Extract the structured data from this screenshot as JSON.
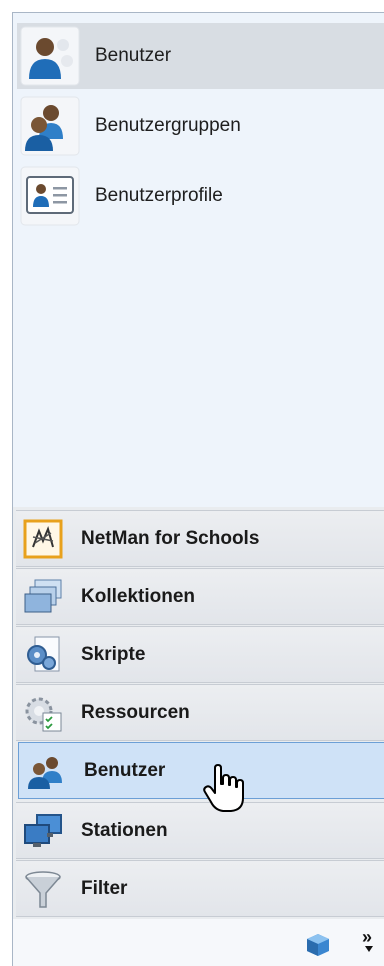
{
  "list": {
    "items": [
      {
        "label": "Benutzer",
        "icon": "user-icon",
        "selected": true
      },
      {
        "label": "Benutzergruppen",
        "icon": "user-group-icon",
        "selected": false
      },
      {
        "label": "Benutzerprofile",
        "icon": "user-profile-icon",
        "selected": false
      }
    ]
  },
  "nav": {
    "items": [
      {
        "label": "NetMan for Schools",
        "icon": "netman-icon"
      },
      {
        "label": "Kollektionen",
        "icon": "collections-icon"
      },
      {
        "label": "Skripte",
        "icon": "scripts-icon"
      },
      {
        "label": "Ressourcen",
        "icon": "resources-icon"
      },
      {
        "label": "Benutzer",
        "icon": "users-icon",
        "active": true
      },
      {
        "label": "Stationen",
        "icon": "stations-icon"
      },
      {
        "label": "Filter",
        "icon": "filter-icon"
      }
    ]
  },
  "bottom": {
    "chevron": "»",
    "icons": [
      "cube-icon",
      "overflow-chevron-icon"
    ]
  },
  "colors": {
    "selected": "#d8dde3",
    "active_nav": "#cfe2f7",
    "active_border": "#6c9fd6"
  }
}
